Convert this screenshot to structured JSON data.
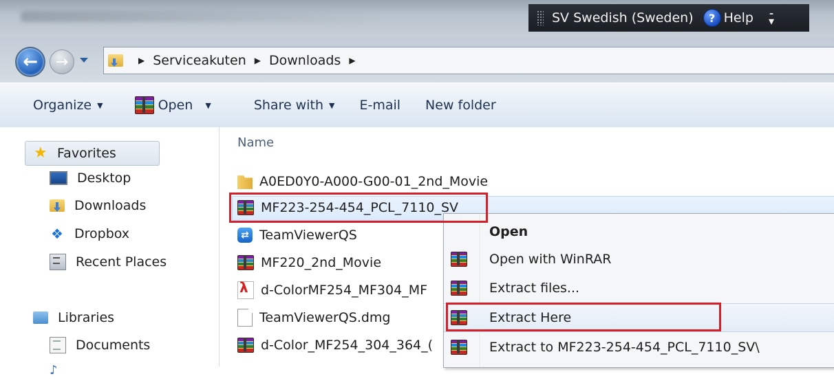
{
  "title_bar": {
    "language": "SV Swedish (Sweden)",
    "help_label": "Help",
    "help_glyph": "?"
  },
  "address_bar": {
    "separator": "▶",
    "path": [
      "Serviceakuten",
      "Downloads"
    ]
  },
  "toolbar": {
    "organize_label": "Organize",
    "open_label": "Open",
    "share_label": "Share with",
    "email_label": "E-mail",
    "new_folder_label": "New folder",
    "caret": "▼"
  },
  "sidebar": {
    "favorites": "Favorites",
    "desktop": "Desktop",
    "downloads": "Downloads",
    "dropbox": "Dropbox",
    "recent_places": "Recent Places",
    "libraries": "Libraries",
    "documents": "Documents"
  },
  "file_list": {
    "column_name": "Name",
    "files": [
      {
        "name": "A0ED0Y0-A000-G00-01_2nd_Movie",
        "icon": "folder-icon"
      },
      {
        "name": "MF223-254-454_PCL_7110_SV",
        "icon": "winrar-icon"
      },
      {
        "name": "TeamViewerQS",
        "icon": "teamviewer-icon"
      },
      {
        "name": "MF220_2nd_Movie",
        "icon": "winrar-icon"
      },
      {
        "name": "d-ColorMF254_MF304_MF",
        "icon": "pdf-icon"
      },
      {
        "name": "TeamViewerQS.dmg",
        "icon": "document-icon"
      },
      {
        "name": "d-Color_MF254_304_364_(",
        "icon": "winrar-icon"
      }
    ]
  },
  "context_menu": {
    "open": "Open",
    "open_with_winrar": "Open with WinRAR",
    "extract_files": "Extract files...",
    "extract_here": "Extract Here",
    "extract_to": "Extract to MF223-254-454_PCL_7110_SV\\"
  },
  "colors": {
    "highlight": "#d3202a",
    "selection": "#dcebfc"
  }
}
